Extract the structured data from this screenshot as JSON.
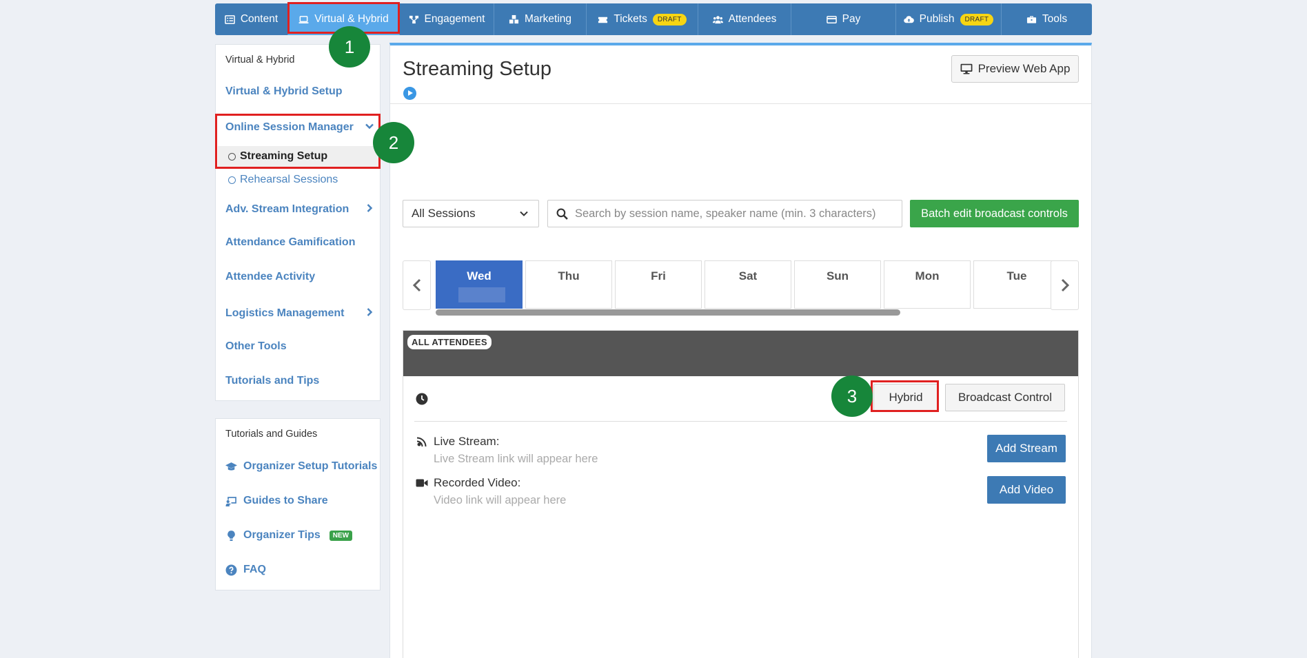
{
  "nav": {
    "tabs": [
      {
        "label": "Content",
        "icon": "list-icon"
      },
      {
        "label": "Virtual & Hybrid",
        "icon": "laptop-icon"
      },
      {
        "label": "Engagement",
        "icon": "network-icon"
      },
      {
        "label": "Marketing",
        "icon": "cubes-icon"
      },
      {
        "label": "Tickets",
        "icon": "ticket-icon",
        "badge": "DRAFT"
      },
      {
        "label": "Attendees",
        "icon": "users-icon"
      },
      {
        "label": "Pay",
        "icon": "card-icon"
      },
      {
        "label": "Publish",
        "icon": "cloud-upload-icon",
        "badge": "DRAFT"
      },
      {
        "label": "Tools",
        "icon": "toolbox-icon"
      }
    ],
    "active_color": "#5aa9ea",
    "bar_color": "#3d7ab4"
  },
  "markers": [
    "1",
    "2",
    "3"
  ],
  "sidebar": {
    "heading": "Virtual & Hybrid",
    "items": [
      {
        "label": "Virtual & Hybrid Setup"
      },
      {
        "label": "Online Session Manager",
        "chevron": "chevron-down-icon"
      },
      {
        "label": "Adv. Stream Integration",
        "chevron": "chevron-right-icon"
      },
      {
        "label": "Attendance Gamification"
      },
      {
        "label": "Attendee Activity"
      },
      {
        "label": "Logistics Management",
        "chevron": "chevron-right-icon"
      },
      {
        "label": "Other Tools"
      },
      {
        "label": "Tutorials and Tips"
      }
    ],
    "subitems": [
      {
        "label": "Streaming Setup",
        "current": true
      },
      {
        "label": "Rehearsal Sessions",
        "current": false
      }
    ]
  },
  "tutorials": {
    "heading": "Tutorials and Guides",
    "items": [
      {
        "label": "Organizer Setup Tutorials",
        "icon": "graduation-cap-icon"
      },
      {
        "label": "Guides to Share",
        "icon": "presentation-icon"
      },
      {
        "label": "Organizer Tips",
        "icon": "lightbulb-icon",
        "badge": "NEW"
      },
      {
        "label": "FAQ",
        "icon": "question-circle-icon"
      }
    ]
  },
  "main": {
    "title": "Streaming Setup",
    "preview_label": "Preview Web App",
    "session_filter": "All Sessions",
    "search_placeholder": "Search by session name, speaker name (min. 3 characters)",
    "batch_label": "Batch edit broadcast controls",
    "days": [
      "Wed",
      "Thu",
      "Fri",
      "Sat",
      "Sun",
      "Mon",
      "Tue"
    ],
    "selected_day": "Wed",
    "session": {
      "audience_badge": "ALL ATTENDEES",
      "hybrid_label": "Hybrid",
      "broadcast_label": "Broadcast Control",
      "live_stream_title": "Live Stream:",
      "live_stream_hint": "Live Stream link will appear here",
      "add_stream_label": "Add Stream",
      "recorded_title": "Recorded Video:",
      "recorded_hint": "Video link will appear here",
      "add_video_label": "Add Video"
    }
  }
}
